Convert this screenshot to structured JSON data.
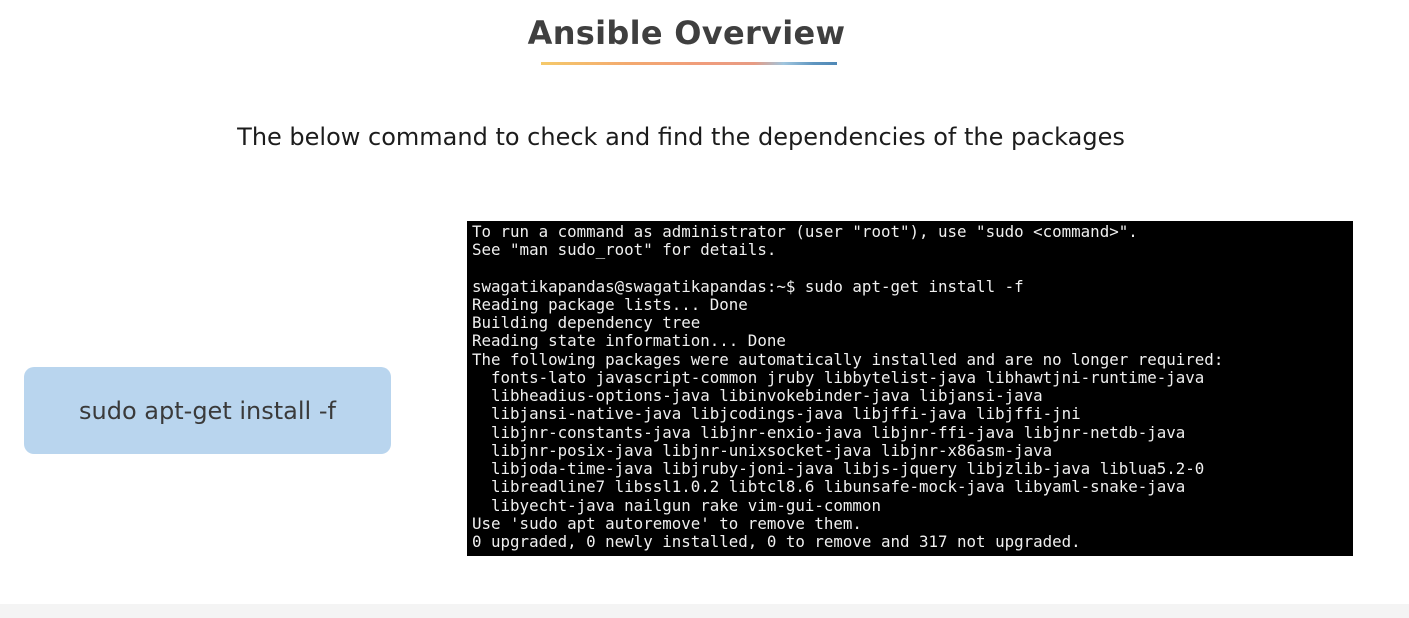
{
  "slide": {
    "title": "Ansible Overview",
    "subtitle": "The below command to check and find the dependencies of the packages",
    "command_label": "sudo apt-get install -f"
  },
  "terminal": {
    "lines": [
      "To run a command as administrator (user \"root\"), use \"sudo <command>\".",
      "See \"man sudo_root\" for details.",
      "",
      "swagatikapandas@swagatikapandas:~$ sudo apt-get install -f",
      "Reading package lists... Done",
      "Building dependency tree",
      "Reading state information... Done",
      "The following packages were automatically installed and are no longer required:",
      "  fonts-lato javascript-common jruby libbytelist-java libhawtjni-runtime-java",
      "  libheadius-options-java libinvokebinder-java libjansi-java",
      "  libjansi-native-java libjcodings-java libjffi-java libjffi-jni",
      "  libjnr-constants-java libjnr-enxio-java libjnr-ffi-java libjnr-netdb-java",
      "  libjnr-posix-java libjnr-unixsocket-java libjnr-x86asm-java",
      "  libjoda-time-java libjruby-joni-java libjs-jquery libjzlib-java liblua5.2-0",
      "  libreadline7 libssl1.0.2 libtcl8.6 libunsafe-mock-java libyaml-snake-java",
      "  libyecht-java nailgun rake vim-gui-common",
      "Use 'sudo apt autoremove' to remove them.",
      "0 upgraded, 0 newly installed, 0 to remove and 317 not upgraded."
    ]
  }
}
